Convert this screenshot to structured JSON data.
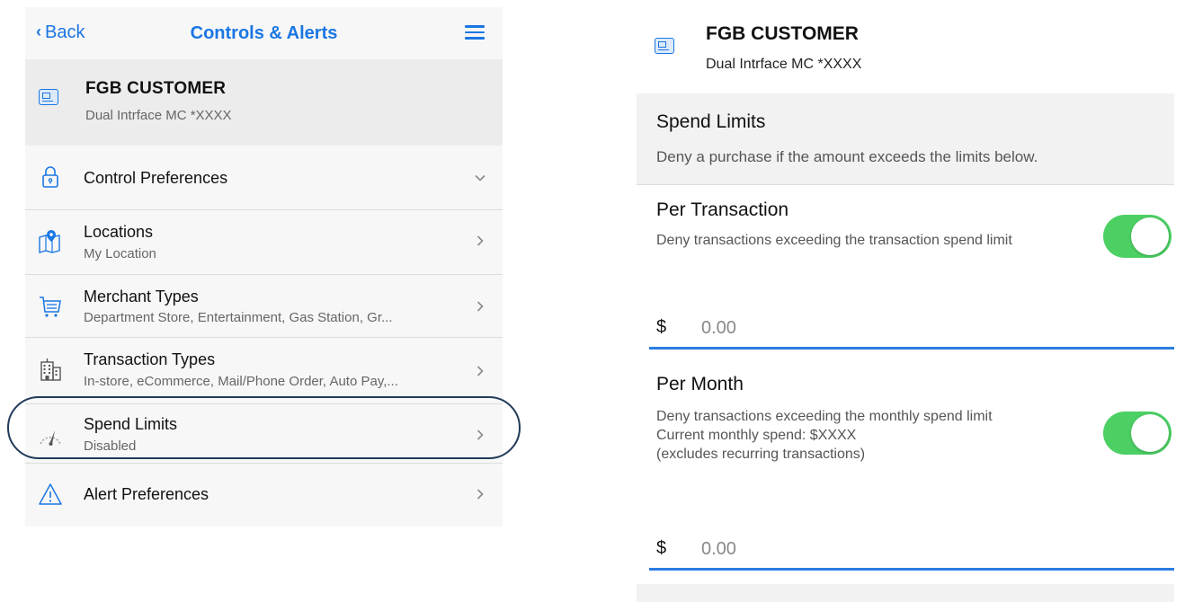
{
  "left": {
    "nav": {
      "back_label": "Back",
      "title": "Controls & Alerts"
    },
    "card": {
      "name": "FGB CUSTOMER",
      "subtitle": "Dual Intrface MC *XXXX"
    },
    "items": [
      {
        "label": "Control Preferences",
        "subtitle": "",
        "icon": "lock-icon",
        "arrow": "chevron-down-icon"
      },
      {
        "label": "Locations",
        "subtitle": "My Location",
        "icon": "map-pin-icon",
        "arrow": "chevron-right-icon"
      },
      {
        "label": "Merchant Types",
        "subtitle": "Department Store, Entertainment, Gas Station, Gr...",
        "icon": "shopping-cart-icon",
        "arrow": "chevron-right-icon"
      },
      {
        "label": "Transaction Types",
        "subtitle": "In-store, eCommerce, Mail/Phone Order, Auto Pay,...",
        "icon": "building-icon",
        "arrow": "chevron-right-icon"
      },
      {
        "label": "Spend Limits",
        "subtitle": "Disabled",
        "icon": "speedometer-icon",
        "arrow": "chevron-right-icon"
      },
      {
        "label": "Alert Preferences",
        "subtitle": "",
        "icon": "warning-icon",
        "arrow": "chevron-right-icon"
      }
    ]
  },
  "right": {
    "card": {
      "name": "FGB CUSTOMER",
      "subtitle": "Dual Intrface MC *XXXX"
    },
    "section": {
      "title": "Spend Limits",
      "description": "Deny a purchase if the amount exceeds the limits below."
    },
    "per_transaction": {
      "title": "Per Transaction",
      "description": "Deny transactions exceeding the transaction spend limit",
      "enabled": true,
      "currency": "$",
      "placeholder": "0.00"
    },
    "per_month": {
      "title": "Per Month",
      "description_line1": "Deny transactions exceeding the monthly spend limit",
      "description_line2": "Current monthly spend: $XXXX",
      "description_line3": "(excludes recurring transactions)",
      "enabled": true,
      "currency": "$",
      "placeholder": "0.00"
    }
  },
  "colors": {
    "accent": "#1a76e3",
    "toggle_on": "#4cd064",
    "highlight_ring": "#213a5a",
    "input_underline": "#2a7de1"
  }
}
